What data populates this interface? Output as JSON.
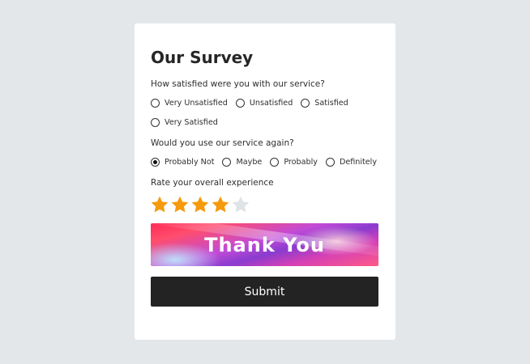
{
  "survey": {
    "title": "Our Survey",
    "q1": {
      "text": "How satisfied were you with our service?",
      "options": [
        "Very Unsatisfied",
        "Unsatisfied",
        "Satisfied",
        "Very Satisfied"
      ],
      "selected": null
    },
    "q2": {
      "text": "Would you use our service again?",
      "options": [
        "Probably Not",
        "Maybe",
        "Probably",
        "Definitely"
      ],
      "selected": "Probably Not"
    },
    "rating": {
      "label": "Rate your overall experience",
      "value": 4,
      "max": 5,
      "filled_color": "#f59a0c",
      "empty_color": "#dfe3e6"
    },
    "banner_text": "Thank You",
    "submit_label": "Submit"
  }
}
